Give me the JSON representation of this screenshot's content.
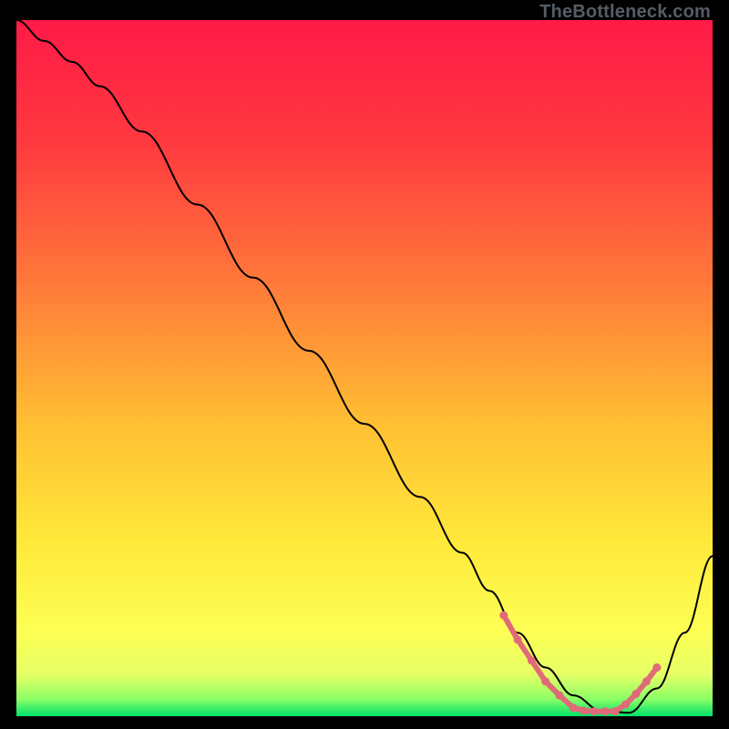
{
  "watermark": "TheBottleneck.com",
  "chart_data": {
    "type": "line",
    "title": "",
    "xlabel": "",
    "ylabel": "",
    "xlim": [
      0,
      100
    ],
    "ylim": [
      0,
      100
    ],
    "grid": false,
    "legend": false,
    "gradient_stops": [
      {
        "offset": 0,
        "color": "#ff1a47"
      },
      {
        "offset": 0.18,
        "color": "#ff3a3f"
      },
      {
        "offset": 0.38,
        "color": "#ff7a3a"
      },
      {
        "offset": 0.58,
        "color": "#ffbf33"
      },
      {
        "offset": 0.75,
        "color": "#ffe93a"
      },
      {
        "offset": 0.88,
        "color": "#fdff55"
      },
      {
        "offset": 0.94,
        "color": "#e6ff66"
      },
      {
        "offset": 0.975,
        "color": "#8dff66"
      },
      {
        "offset": 1.0,
        "color": "#00e06a"
      }
    ],
    "series": [
      {
        "name": "curve",
        "type": "line",
        "color": "#000000",
        "width": 2,
        "x": [
          0,
          4,
          8,
          12,
          18,
          26,
          34,
          42,
          50,
          58,
          64,
          68,
          72,
          76,
          80,
          84,
          88,
          92,
          96,
          100
        ],
        "y": [
          100,
          97,
          94,
          90.5,
          84,
          73.5,
          63,
          52.5,
          42,
          31.5,
          23.5,
          18,
          12,
          7,
          3,
          0.8,
          0.5,
          4,
          12,
          23
        ]
      },
      {
        "name": "sweet-spot",
        "type": "marker-line",
        "color": "#e06a78",
        "width": 6,
        "x": [
          70,
          72,
          74,
          76,
          78,
          80,
          81.5,
          83,
          84.5,
          86,
          87.5,
          89,
          90.5,
          92
        ],
        "y": [
          14.5,
          11,
          8,
          5,
          3,
          1.2,
          0.8,
          0.7,
          0.7,
          0.7,
          1.7,
          3.2,
          5,
          7
        ]
      }
    ]
  }
}
